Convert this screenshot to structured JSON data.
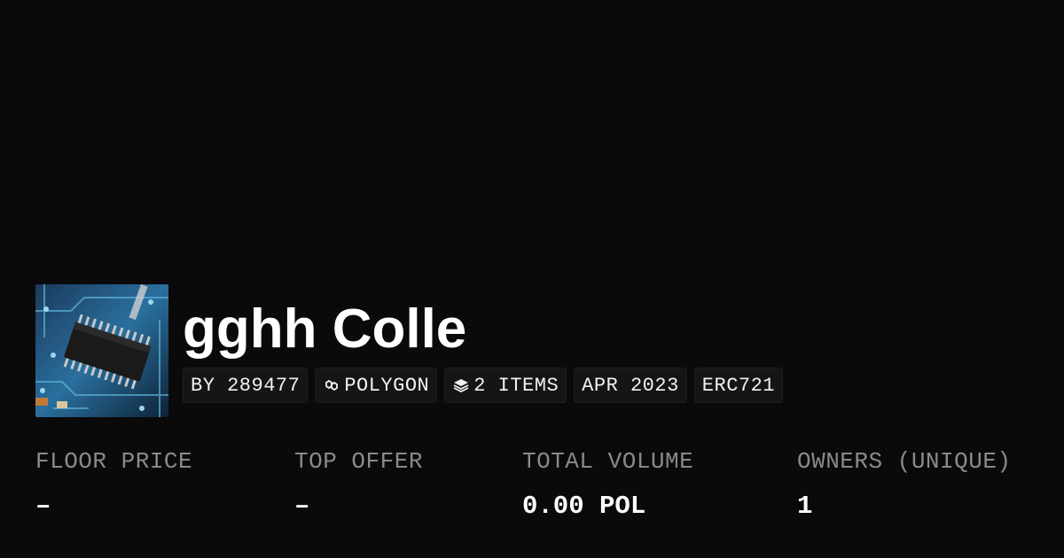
{
  "collection": {
    "title": "gghh Colle"
  },
  "badges": {
    "creator": "BY 289477",
    "chain": "POLYGON",
    "items": "2 ITEMS",
    "date": "APR 2023",
    "standard": "ERC721"
  },
  "icons": {
    "chain": "polygon-chain-icon",
    "items": "layers-icon"
  },
  "stats": {
    "floor_price": {
      "label": "FLOOR PRICE",
      "value": "–"
    },
    "top_offer": {
      "label": "TOP OFFER",
      "value": "–"
    },
    "total_volume": {
      "label": "TOTAL VOLUME",
      "value": "0.00 POL"
    },
    "owners": {
      "label": "OWNERS (UNIQUE)",
      "value": "1"
    }
  },
  "colors": {
    "background": "#0a0a0a",
    "badge_background": "#151515",
    "label_gray": "#8a8a8a",
    "text": "#ffffff"
  }
}
